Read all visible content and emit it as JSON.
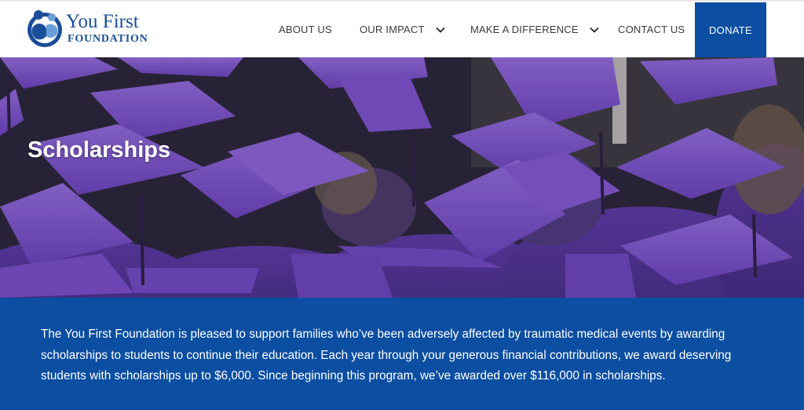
{
  "brand": {
    "name_line1": "You First",
    "name_line2": "FOUNDATION",
    "colors": {
      "primary": "#0b4ea2",
      "logo": "#1a4e9a",
      "hero_purple": "#7b52c9"
    }
  },
  "nav": {
    "items": [
      {
        "label": "ABOUT US",
        "has_dropdown": false
      },
      {
        "label": "OUR IMPACT",
        "has_dropdown": true
      },
      {
        "label": "MAKE A DIFFERENCE",
        "has_dropdown": true
      },
      {
        "label": "CONTACT US",
        "has_dropdown": false
      }
    ],
    "donate_label": "DONATE",
    "dropdown_icon": "chevron-down-icon"
  },
  "hero": {
    "title": "Scholarships",
    "image": "graduation-caps-photo"
  },
  "intro": {
    "text": "The You First Foundation is pleased to support families who’ve been adversely affected by traumatic medical events by awarding scholarships to students to continue their education. Each year through your generous financial contributions, we award deserving students with scholarships up to $6,000. Since beginning this program, we’ve awarded over $116,000 in scholarships."
  }
}
